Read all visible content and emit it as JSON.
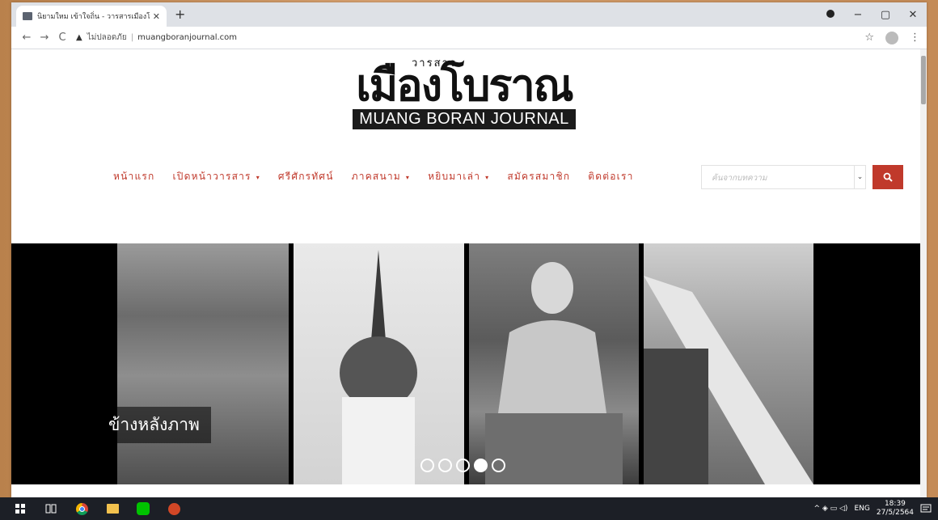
{
  "browser": {
    "tab_title": "นิยามใหม เข้าใจถิ่น - วารสารเมืองโบรา",
    "tab_close": "✕",
    "new_tab": "+",
    "address_warning": "▲",
    "address_security": "ไม่ปลอดภัย",
    "address_separator": "|",
    "address_url": "muangboranjournal.com",
    "back": "←",
    "forward": "→",
    "reload": "C",
    "star": "☆",
    "menu": "⋮",
    "minimize": "−",
    "maximize": "▢",
    "close": "✕"
  },
  "site": {
    "logo_small": "วารสาร",
    "logo_big": "เมืองโบราณ",
    "logo_english": "MUANG BORAN JOURNAL",
    "menu": [
      {
        "label": "หน้าแรก",
        "has_caret": false
      },
      {
        "label": "เปิดหน้าวารสาร",
        "has_caret": true
      },
      {
        "label": "ศรีศักรทัศน์",
        "has_caret": false
      },
      {
        "label": "ภาคสนาม",
        "has_caret": true
      },
      {
        "label": "หยิบมาเล่า",
        "has_caret": true
      },
      {
        "label": "สมัครสมาชิก",
        "has_caret": false
      },
      {
        "label": "ติดต่อเรา",
        "has_caret": false
      }
    ],
    "caret": "▾",
    "search_placeholder": "ค้นจากบทความ",
    "search_dropdown": "⌄",
    "slider_caption": "ข้างหลังภาพ",
    "slider_dot_count": 5,
    "slider_active_dot": 4
  },
  "taskbar": {
    "lang": "ENG",
    "time": "18:39",
    "date": "27/5/2564",
    "tray_icons": "^ ◈ ▭ ◁)"
  },
  "colors": {
    "accent": "#c0392b",
    "taskbar": "#1c1f26"
  }
}
